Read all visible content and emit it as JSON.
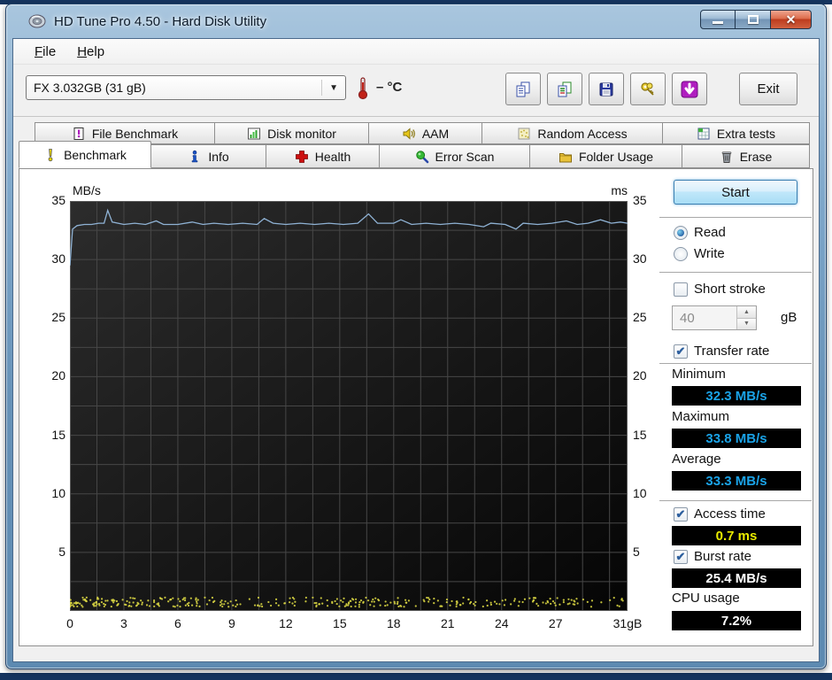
{
  "window": {
    "title": "HD Tune Pro 4.50 - Hard Disk Utility",
    "close_glyph": "✕"
  },
  "menu": {
    "items": [
      {
        "label": "File"
      },
      {
        "label": "Help"
      }
    ]
  },
  "toolbar": {
    "drive_select": "FX 3.032GB (31 gB)",
    "dropdown_arrow": "▼",
    "temperature": "– °C",
    "buttons": [
      {
        "name": "copy-text-button"
      },
      {
        "name": "copy-image-button"
      },
      {
        "name": "save-button"
      },
      {
        "name": "options-button"
      },
      {
        "name": "download-button"
      }
    ],
    "exit_label": "Exit"
  },
  "tabs": {
    "row1": [
      {
        "label": "File Benchmark",
        "icon": "file-benchmark-icon"
      },
      {
        "label": "Disk monitor",
        "icon": "disk-monitor-icon"
      },
      {
        "label": "AAM",
        "icon": "aam-icon"
      },
      {
        "label": "Random Access",
        "icon": "random-access-icon"
      },
      {
        "label": "Extra tests",
        "icon": "extra-tests-icon"
      }
    ],
    "row2": [
      {
        "label": "Benchmark",
        "icon": "benchmark-icon",
        "active": true
      },
      {
        "label": "Info",
        "icon": "info-icon"
      },
      {
        "label": "Health",
        "icon": "health-icon"
      },
      {
        "label": "Error Scan",
        "icon": "error-scan-icon"
      },
      {
        "label": "Folder Usage",
        "icon": "folder-usage-icon"
      },
      {
        "label": "Erase",
        "icon": "erase-icon"
      }
    ]
  },
  "benchmark": {
    "start_label": "Start",
    "mode": {
      "read_label": "Read",
      "write_label": "Write",
      "selected": "Read"
    },
    "short_stroke": {
      "label": "Short stroke",
      "checked": false,
      "capacity_value": "40",
      "capacity_unit": "gB"
    },
    "transfer_rate": {
      "label": "Transfer rate",
      "checked": true
    },
    "access_time": {
      "label": "Access time",
      "checked": true,
      "value": "0.7 ms"
    },
    "burst_rate": {
      "label": "Burst rate",
      "checked": true,
      "value": "25.4 MB/s"
    },
    "stats": {
      "minimum_label": "Minimum",
      "minimum": "32.3 MB/s",
      "maximum_label": "Maximum",
      "maximum": "33.8 MB/s",
      "average_label": "Average",
      "average": "33.3 MB/s",
      "cpu_label": "CPU usage",
      "cpu": "7.2%"
    },
    "check_glyph": "✔"
  },
  "chart_data": {
    "type": "line",
    "title": "HD Tune benchmark transfer rate and access time",
    "ylabel_left": "MB/s",
    "ylabel_right": "ms",
    "xlim": [
      0,
      31
    ],
    "ylim": [
      0,
      35
    ],
    "grid": true,
    "grid_step_x": 1.5,
    "grid_step_y": 2.5,
    "x_ticks": [
      {
        "v": 0,
        "label": "0"
      },
      {
        "v": 3,
        "label": "3"
      },
      {
        "v": 6,
        "label": "6"
      },
      {
        "v": 9,
        "label": "9"
      },
      {
        "v": 12,
        "label": "12"
      },
      {
        "v": 15,
        "label": "15"
      },
      {
        "v": 18,
        "label": "18"
      },
      {
        "v": 21,
        "label": "21"
      },
      {
        "v": 24,
        "label": "24"
      },
      {
        "v": 27,
        "label": "27"
      },
      {
        "v": 31,
        "label": "31gB"
      }
    ],
    "y_ticks_left": [
      35,
      30,
      25,
      20,
      15,
      10,
      5
    ],
    "y_ticks_right": [
      35,
      30,
      25,
      20,
      15,
      10,
      5
    ],
    "colors": {
      "plot_bg_top": "#2c2c2c",
      "plot_bg_bottom": "#050505",
      "grid": "#474747",
      "frame": "#5a5a5a",
      "line": "#8fb2d4",
      "scatter": "#d8d542"
    },
    "series": [
      {
        "name": "Transfer rate (MB/s)",
        "color": "#8fb2d4",
        "points": [
          [
            0,
            29.5
          ],
          [
            0.15,
            32.6
          ],
          [
            0.4,
            32.9
          ],
          [
            0.8,
            33.0
          ],
          [
            1.2,
            33.0
          ],
          [
            1.6,
            33.1
          ],
          [
            1.9,
            33.1
          ],
          [
            2.1,
            34.2
          ],
          [
            2.35,
            33.2
          ],
          [
            3,
            33.0
          ],
          [
            3.6,
            33.1
          ],
          [
            4.2,
            33.0
          ],
          [
            4.8,
            33.3
          ],
          [
            5.2,
            33.0
          ],
          [
            6,
            33.0
          ],
          [
            6.8,
            33.2
          ],
          [
            7.4,
            33.0
          ],
          [
            8,
            33.1
          ],
          [
            8.8,
            33.0
          ],
          [
            9.6,
            33.1
          ],
          [
            10.4,
            33.0
          ],
          [
            10.8,
            33.5
          ],
          [
            11.3,
            33.1
          ],
          [
            12,
            33.0
          ],
          [
            12.8,
            33.1
          ],
          [
            13.6,
            33.0
          ],
          [
            14.4,
            33.1
          ],
          [
            15.2,
            33.0
          ],
          [
            16,
            33.1
          ],
          [
            16.6,
            33.9
          ],
          [
            17.1,
            33.1
          ],
          [
            18,
            33.1
          ],
          [
            18.4,
            33.4
          ],
          [
            19,
            33.0
          ],
          [
            19.8,
            33.1
          ],
          [
            20.6,
            33.0
          ],
          [
            21.4,
            33.1
          ],
          [
            22.2,
            33.0
          ],
          [
            23,
            32.8
          ],
          [
            23.4,
            33.1
          ],
          [
            24.2,
            33.0
          ],
          [
            24.8,
            32.6
          ],
          [
            25.2,
            33.1
          ],
          [
            26,
            33.0
          ],
          [
            26.8,
            33.1
          ],
          [
            27.6,
            33.3
          ],
          [
            28.2,
            33.0
          ],
          [
            28.8,
            33.1
          ],
          [
            29.5,
            33.4
          ],
          [
            30.1,
            33.1
          ],
          [
            30.6,
            33.2
          ],
          [
            31,
            33.1
          ]
        ]
      }
    ],
    "scatter": {
      "name": "Access time (ms)",
      "color": "#d8d542",
      "typical_ms": 0.7,
      "ms_min": 0.35,
      "ms_max": 1.15,
      "count": 330,
      "seed": 7,
      "left_bias": 1.35
    }
  }
}
